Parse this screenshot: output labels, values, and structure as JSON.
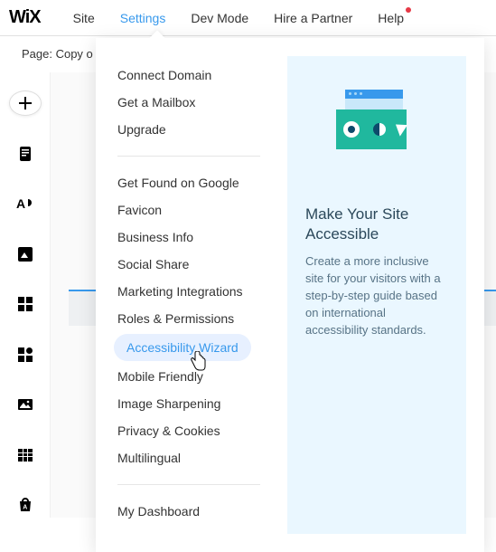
{
  "logo": "WiX",
  "topnav": {
    "site": "Site",
    "settings": "Settings",
    "devmode": "Dev Mode",
    "hire": "Hire a Partner",
    "help": "Help"
  },
  "page_label": "Page: Copy o",
  "settings_menu": {
    "group1": {
      "connect_domain": "Connect Domain",
      "get_mailbox": "Get a Mailbox",
      "upgrade": "Upgrade"
    },
    "group2": {
      "get_found": "Get Found on Google",
      "favicon": "Favicon",
      "business_info": "Business Info",
      "social_share": "Social Share",
      "marketing_integrations": "Marketing Integrations",
      "roles_permissions": "Roles & Permissions",
      "accessibility_wizard": "Accessibility Wizard",
      "mobile_friendly": "Mobile Friendly",
      "image_sharpening": "Image Sharpening",
      "privacy_cookies": "Privacy & Cookies",
      "multilingual": "Multilingual"
    },
    "group3": {
      "my_dashboard": "My Dashboard"
    }
  },
  "promo": {
    "title": "Make Your Site Accessible",
    "desc": "Create a more inclusive site for your visitors with a step-by-step guide based on international accessibility standards."
  }
}
